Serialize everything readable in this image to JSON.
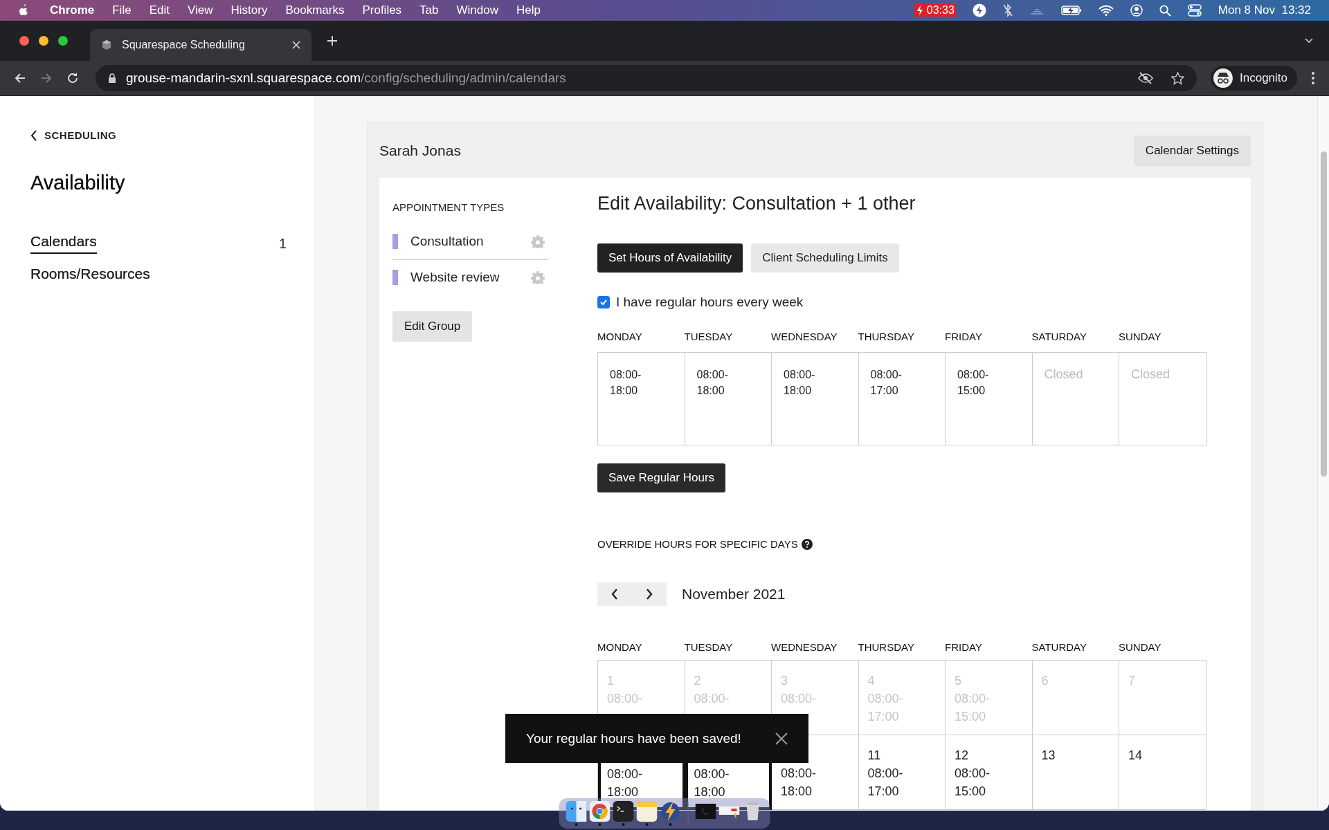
{
  "menu_bar": {
    "app": "Chrome",
    "menus": [
      "File",
      "Edit",
      "View",
      "History",
      "Bookmarks",
      "Profiles",
      "Tab",
      "Window",
      "Help"
    ],
    "timer": "03:33",
    "clock": "Mon 8 Nov  13:32"
  },
  "browser": {
    "tab_title": "Squarespace Scheduling",
    "url_host": "grouse-mandarin-sxnl.squarespace.com",
    "url_path": "/config/scheduling/admin/calendars",
    "profile": "Incognito"
  },
  "sidebar": {
    "back_link": "SCHEDULING",
    "title": "Availability",
    "items": [
      {
        "label": "Calendars",
        "count": "1",
        "selected": true
      },
      {
        "label": "Rooms/Resources",
        "selected": false
      }
    ]
  },
  "calendar": {
    "name": "Sarah Jonas",
    "settings_button": "Calendar Settings"
  },
  "appointment_types": {
    "heading": "APPOINTMENT TYPES",
    "items": [
      {
        "name": "Consultation",
        "color": "#a99be6"
      },
      {
        "name": "Website review",
        "color": "#a99be6"
      }
    ],
    "edit_button": "Edit Group"
  },
  "availability": {
    "title": "Edit Availability: Consultation + 1 other",
    "tabs": [
      {
        "label": "Set Hours of Availability",
        "selected": true
      },
      {
        "label": "Client Scheduling Limits",
        "selected": false
      }
    ],
    "regular_hours": {
      "label": "I have regular hours every week",
      "checked": true
    },
    "weekly": [
      {
        "day": "MONDAY",
        "hours": [
          "08:00-",
          "18:00"
        ],
        "closed": false
      },
      {
        "day": "TUESDAY",
        "hours": [
          "08:00-",
          "18:00"
        ],
        "closed": false
      },
      {
        "day": "WEDNESDAY",
        "hours": [
          "08:00-",
          "18:00"
        ],
        "closed": false
      },
      {
        "day": "THURSDAY",
        "hours": [
          "08:00-",
          "17:00"
        ],
        "closed": false
      },
      {
        "day": "FRIDAY",
        "hours": [
          "08:00-",
          "15:00"
        ],
        "closed": false
      },
      {
        "day": "SATURDAY",
        "hours": [
          "Closed"
        ],
        "closed": true
      },
      {
        "day": "SUNDAY",
        "hours": [
          "Closed"
        ],
        "closed": true
      }
    ],
    "save_button": "Save Regular Hours",
    "override_heading": "OVERRIDE HOURS FOR SPECIFIC DAYS",
    "month": "November 2021",
    "month_days": [
      "MONDAY",
      "TUESDAY",
      "WEDNESDAY",
      "THURSDAY",
      "FRIDAY",
      "SATURDAY",
      "SUNDAY"
    ],
    "weeks": [
      [
        {
          "date": "1",
          "hours": [
            "08:00-"
          ],
          "past": true,
          "selected": false
        },
        {
          "date": "2",
          "hours": [
            "08:00-"
          ],
          "past": true,
          "selected": false
        },
        {
          "date": "3",
          "hours": [
            "08:00-"
          ],
          "past": true,
          "selected": false
        },
        {
          "date": "4",
          "hours": [
            "08:00-",
            "17:00"
          ],
          "past": true,
          "selected": false
        },
        {
          "date": "5",
          "hours": [
            "08:00-",
            "15:00"
          ],
          "past": true,
          "selected": false
        },
        {
          "date": "6",
          "past": true,
          "selected": false
        },
        {
          "date": "7",
          "past": true,
          "selected": false
        }
      ],
      [
        {
          "hours": [
            "08:00-",
            "18:00"
          ],
          "past": false,
          "selected": true
        },
        {
          "hours": [
            "08:00-",
            "18:00"
          ],
          "past": false,
          "selected": true
        },
        {
          "hours": [
            "08:00-",
            "18:00"
          ],
          "past": false,
          "selected": false
        },
        {
          "date": "11",
          "hours": [
            "08:00-",
            "17:00"
          ],
          "past": false,
          "selected": false
        },
        {
          "date": "12",
          "hours": [
            "08:00-",
            "15:00"
          ],
          "past": false,
          "selected": false
        },
        {
          "date": "13",
          "past": false,
          "selected": false
        },
        {
          "date": "14",
          "past": false,
          "selected": false
        }
      ]
    ]
  },
  "toast": {
    "message": "Your regular hours have been saved!"
  },
  "dock": {
    "apps": [
      {
        "kind": "finder",
        "running": true
      },
      {
        "kind": "chrome",
        "running": true
      },
      {
        "kind": "terminal",
        "running": true
      },
      {
        "kind": "notes",
        "running": true
      },
      {
        "kind": "bolt",
        "running": true
      },
      {
        "kind": "window-dark",
        "running": false
      },
      {
        "kind": "window-light",
        "running": false
      },
      {
        "kind": "trash",
        "running": false
      }
    ]
  }
}
